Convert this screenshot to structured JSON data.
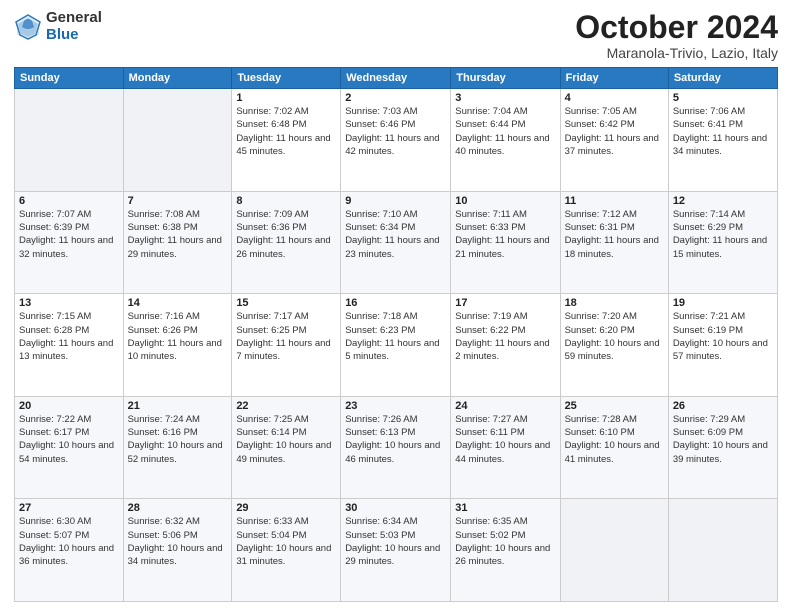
{
  "logo": {
    "general": "General",
    "blue": "Blue"
  },
  "header": {
    "month": "October 2024",
    "location": "Maranola-Trivio, Lazio, Italy"
  },
  "weekdays": [
    "Sunday",
    "Monday",
    "Tuesday",
    "Wednesday",
    "Thursday",
    "Friday",
    "Saturday"
  ],
  "weeks": [
    [
      {
        "day": "",
        "info": ""
      },
      {
        "day": "",
        "info": ""
      },
      {
        "day": "1",
        "info": "Sunrise: 7:02 AM\nSunset: 6:48 PM\nDaylight: 11 hours and 45 minutes."
      },
      {
        "day": "2",
        "info": "Sunrise: 7:03 AM\nSunset: 6:46 PM\nDaylight: 11 hours and 42 minutes."
      },
      {
        "day": "3",
        "info": "Sunrise: 7:04 AM\nSunset: 6:44 PM\nDaylight: 11 hours and 40 minutes."
      },
      {
        "day": "4",
        "info": "Sunrise: 7:05 AM\nSunset: 6:42 PM\nDaylight: 11 hours and 37 minutes."
      },
      {
        "day": "5",
        "info": "Sunrise: 7:06 AM\nSunset: 6:41 PM\nDaylight: 11 hours and 34 minutes."
      }
    ],
    [
      {
        "day": "6",
        "info": "Sunrise: 7:07 AM\nSunset: 6:39 PM\nDaylight: 11 hours and 32 minutes."
      },
      {
        "day": "7",
        "info": "Sunrise: 7:08 AM\nSunset: 6:38 PM\nDaylight: 11 hours and 29 minutes."
      },
      {
        "day": "8",
        "info": "Sunrise: 7:09 AM\nSunset: 6:36 PM\nDaylight: 11 hours and 26 minutes."
      },
      {
        "day": "9",
        "info": "Sunrise: 7:10 AM\nSunset: 6:34 PM\nDaylight: 11 hours and 23 minutes."
      },
      {
        "day": "10",
        "info": "Sunrise: 7:11 AM\nSunset: 6:33 PM\nDaylight: 11 hours and 21 minutes."
      },
      {
        "day": "11",
        "info": "Sunrise: 7:12 AM\nSunset: 6:31 PM\nDaylight: 11 hours and 18 minutes."
      },
      {
        "day": "12",
        "info": "Sunrise: 7:14 AM\nSunset: 6:29 PM\nDaylight: 11 hours and 15 minutes."
      }
    ],
    [
      {
        "day": "13",
        "info": "Sunrise: 7:15 AM\nSunset: 6:28 PM\nDaylight: 11 hours and 13 minutes."
      },
      {
        "day": "14",
        "info": "Sunrise: 7:16 AM\nSunset: 6:26 PM\nDaylight: 11 hours and 10 minutes."
      },
      {
        "day": "15",
        "info": "Sunrise: 7:17 AM\nSunset: 6:25 PM\nDaylight: 11 hours and 7 minutes."
      },
      {
        "day": "16",
        "info": "Sunrise: 7:18 AM\nSunset: 6:23 PM\nDaylight: 11 hours and 5 minutes."
      },
      {
        "day": "17",
        "info": "Sunrise: 7:19 AM\nSunset: 6:22 PM\nDaylight: 11 hours and 2 minutes."
      },
      {
        "day": "18",
        "info": "Sunrise: 7:20 AM\nSunset: 6:20 PM\nDaylight: 10 hours and 59 minutes."
      },
      {
        "day": "19",
        "info": "Sunrise: 7:21 AM\nSunset: 6:19 PM\nDaylight: 10 hours and 57 minutes."
      }
    ],
    [
      {
        "day": "20",
        "info": "Sunrise: 7:22 AM\nSunset: 6:17 PM\nDaylight: 10 hours and 54 minutes."
      },
      {
        "day": "21",
        "info": "Sunrise: 7:24 AM\nSunset: 6:16 PM\nDaylight: 10 hours and 52 minutes."
      },
      {
        "day": "22",
        "info": "Sunrise: 7:25 AM\nSunset: 6:14 PM\nDaylight: 10 hours and 49 minutes."
      },
      {
        "day": "23",
        "info": "Sunrise: 7:26 AM\nSunset: 6:13 PM\nDaylight: 10 hours and 46 minutes."
      },
      {
        "day": "24",
        "info": "Sunrise: 7:27 AM\nSunset: 6:11 PM\nDaylight: 10 hours and 44 minutes."
      },
      {
        "day": "25",
        "info": "Sunrise: 7:28 AM\nSunset: 6:10 PM\nDaylight: 10 hours and 41 minutes."
      },
      {
        "day": "26",
        "info": "Sunrise: 7:29 AM\nSunset: 6:09 PM\nDaylight: 10 hours and 39 minutes."
      }
    ],
    [
      {
        "day": "27",
        "info": "Sunrise: 6:30 AM\nSunset: 5:07 PM\nDaylight: 10 hours and 36 minutes."
      },
      {
        "day": "28",
        "info": "Sunrise: 6:32 AM\nSunset: 5:06 PM\nDaylight: 10 hours and 34 minutes."
      },
      {
        "day": "29",
        "info": "Sunrise: 6:33 AM\nSunset: 5:04 PM\nDaylight: 10 hours and 31 minutes."
      },
      {
        "day": "30",
        "info": "Sunrise: 6:34 AM\nSunset: 5:03 PM\nDaylight: 10 hours and 29 minutes."
      },
      {
        "day": "31",
        "info": "Sunrise: 6:35 AM\nSunset: 5:02 PM\nDaylight: 10 hours and 26 minutes."
      },
      {
        "day": "",
        "info": ""
      },
      {
        "day": "",
        "info": ""
      }
    ]
  ]
}
